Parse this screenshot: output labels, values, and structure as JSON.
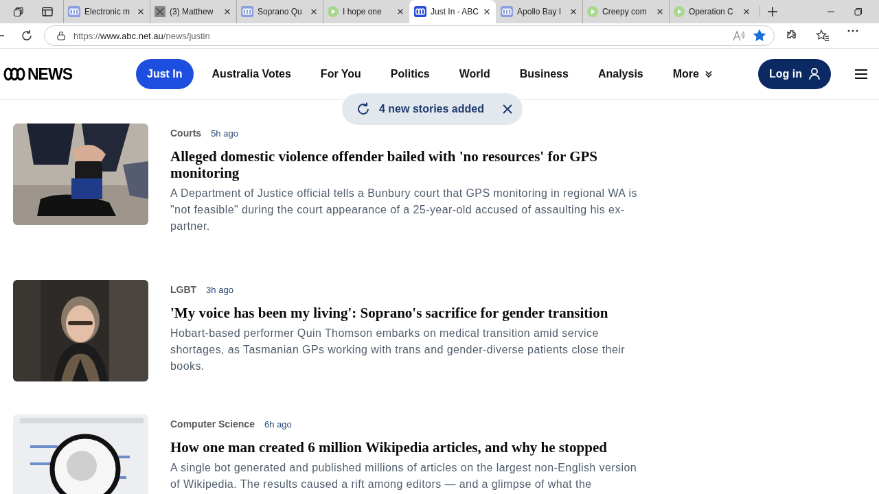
{
  "browser": {
    "tabs": [
      {
        "title": "Electronic m",
        "kind": "abc",
        "selected": false
      },
      {
        "title": "(3) Matthew",
        "kind": "x",
        "selected": false
      },
      {
        "title": "Soprano Qu",
        "kind": "abc",
        "selected": false
      },
      {
        "title": "I hope one",
        "kind": "play",
        "selected": false
      },
      {
        "title": "Just In - ABC",
        "kind": "abc",
        "selected": true
      },
      {
        "title": "Apollo Bay I",
        "kind": "abc",
        "selected": false
      },
      {
        "title": "Creepy com",
        "kind": "play",
        "selected": false
      },
      {
        "title": "Operation C",
        "kind": "play",
        "selected": false
      }
    ],
    "address": {
      "scheme": "https://",
      "host": "www.abc.net.au",
      "path": "/news/justin"
    },
    "favorited": true
  },
  "site": {
    "logo": "NEWS",
    "nav": [
      {
        "label": "Just In",
        "selected": true
      },
      {
        "label": "Australia Votes",
        "selected": false
      },
      {
        "label": "For You",
        "selected": false
      },
      {
        "label": "Politics",
        "selected": false
      },
      {
        "label": "World",
        "selected": false
      },
      {
        "label": "Business",
        "selected": false
      },
      {
        "label": "Analysis",
        "selected": false
      },
      {
        "label": "More",
        "selected": false,
        "kind": "dropdown"
      }
    ],
    "login": "Log in"
  },
  "toast": {
    "text": "4 new stories added"
  },
  "articles": [
    {
      "category": "Courts",
      "time": "5h ago",
      "headline": "Alleged domestic violence offender bailed with 'no resources' for GPS monitoring",
      "summary": "A Department of Justice official tells a Bunbury court that GPS monitoring in regional WA is \"not feasible\" during the court appearance of a 25-year-old accused of assaulting his ex-partner.",
      "kind": "picture"
    },
    {
      "category": "LGBT",
      "time": "3h ago",
      "headline": "'My voice has been my living': Soprano's sacrifice for gender transition",
      "summary": "Hobart-based performer Quin Thomson embarks on medical transition amid service shortages, as Tasmanian GPs working with trans and gender-diverse patients close their books.",
      "kind": "picture"
    },
    {
      "category": "Computer Science",
      "time": "6h ago",
      "headline": "How one man created 6 million Wikipedia articles, and why he stopped",
      "summary": "A single bot generated and published millions of articles on the largest non-English version of Wikipedia. The results caused a rift among editors — and a glimpse of what the",
      "kind": "picture"
    }
  ]
}
